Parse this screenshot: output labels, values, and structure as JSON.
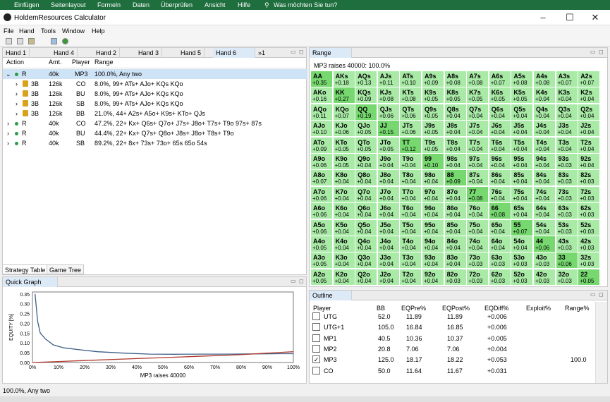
{
  "ribbon": [
    "Einfügen",
    "Seitenlayout",
    "Formeln",
    "Daten",
    "Überprüfen",
    "Ansicht",
    "Hilfe",
    "Was möchten Sie tun?"
  ],
  "window": {
    "title": "HoldemResources Calculator"
  },
  "menu": [
    "File",
    "Hand",
    "Tools",
    "Window",
    "Help"
  ],
  "hand_tabs": [
    "Hand 1",
    "Hand 4",
    "Hand 2",
    "Hand 3",
    "Hand 5",
    "Hand 6",
    "»1"
  ],
  "tree": {
    "headers": [
      "Action",
      "Amt.",
      "Player",
      "Range"
    ],
    "rows": [
      {
        "action": "R",
        "amt": "40k",
        "player": "MP3",
        "range": "100.0%, Any two"
      },
      {
        "action": "3B",
        "amt": "126k",
        "player": "CO",
        "range": "8.0%, 99+ ATs+ AJo+ KQs KQo"
      },
      {
        "action": "3B",
        "amt": "126k",
        "player": "BU",
        "range": "8.0%, 99+ ATs+ AJo+ KQs KQo"
      },
      {
        "action": "3B",
        "amt": "126k",
        "player": "SB",
        "range": "8.0%, 99+ ATs+ AJo+ KQs KQo"
      },
      {
        "action": "3B",
        "amt": "126k",
        "player": "BB",
        "range": "21.0%, 44+ A2s+ A5o+ K9s+ KTo+ QJs"
      },
      {
        "action": "R",
        "amt": "40k",
        "player": "CO",
        "range": "47.2%, 22+ Kx+ Q6s+ Q7o+ J7s+ J8o+ T7s+ T9o 97s+ 87s"
      },
      {
        "action": "R",
        "amt": "40k",
        "player": "BU",
        "range": "44.4%, 22+ Kx+ Q7s+ Q8o+ J8s+ J8o+ T8s+ T9o"
      },
      {
        "action": "R",
        "amt": "40k",
        "player": "SB",
        "range": "89.2%, 22+ 8x+ 73s+ 73o+ 65s 65o 54s"
      }
    ],
    "bottom_tabs": [
      "Strategy Table",
      "Game Tree"
    ]
  },
  "range_panel": {
    "tab": "Range",
    "subtitle": "MP3 raises 40000: 100.0%",
    "hands": [
      [
        "AA",
        "AKs",
        "AQs",
        "AJs",
        "ATs",
        "A9s",
        "A8s",
        "A7s",
        "A6s",
        "A5s",
        "A4s",
        "A3s",
        "A2s"
      ],
      [
        "AKo",
        "KK",
        "KQs",
        "KJs",
        "KTs",
        "K9s",
        "K8s",
        "K7s",
        "K6s",
        "K5s",
        "K4s",
        "K3s",
        "K2s"
      ],
      [
        "AQo",
        "KQo",
        "QQ",
        "QJs",
        "QTs",
        "Q9s",
        "Q8s",
        "Q7s",
        "Q6s",
        "Q5s",
        "Q4s",
        "Q3s",
        "Q2s"
      ],
      [
        "AJo",
        "KJo",
        "QJo",
        "JJ",
        "JTs",
        "J9s",
        "J8s",
        "J7s",
        "J6s",
        "J5s",
        "J4s",
        "J3s",
        "J2s"
      ],
      [
        "ATo",
        "KTo",
        "QTo",
        "JTo",
        "TT",
        "T9s",
        "T8s",
        "T7s",
        "T6s",
        "T5s",
        "T4s",
        "T3s",
        "T2s"
      ],
      [
        "A9o",
        "K9o",
        "Q9o",
        "J9o",
        "T9o",
        "99",
        "98s",
        "97s",
        "96s",
        "95s",
        "94s",
        "93s",
        "92s"
      ],
      [
        "A8o",
        "K8o",
        "Q8o",
        "J8o",
        "T8o",
        "98o",
        "88",
        "87s",
        "86s",
        "85s",
        "84s",
        "83s",
        "82s"
      ],
      [
        "A7o",
        "K7o",
        "Q7o",
        "J7o",
        "T7o",
        "97o",
        "87o",
        "77",
        "76s",
        "75s",
        "74s",
        "73s",
        "72s"
      ],
      [
        "A6o",
        "K6o",
        "Q6o",
        "J6o",
        "T6o",
        "96o",
        "86o",
        "76o",
        "66",
        "65s",
        "64s",
        "63s",
        "62s"
      ],
      [
        "A5o",
        "K5o",
        "Q5o",
        "J5o",
        "T5o",
        "95o",
        "85o",
        "75o",
        "65o",
        "55",
        "54s",
        "53s",
        "52s"
      ],
      [
        "A4o",
        "K4o",
        "Q4o",
        "J4o",
        "T4o",
        "94o",
        "84o",
        "74o",
        "64o",
        "54o",
        "44",
        "43s",
        "42s"
      ],
      [
        "A3o",
        "K3o",
        "Q3o",
        "J3o",
        "T3o",
        "93o",
        "83o",
        "73o",
        "63o",
        "53o",
        "43o",
        "33",
        "32s"
      ],
      [
        "A2o",
        "K2o",
        "Q2o",
        "J2o",
        "T2o",
        "92o",
        "82o",
        "72o",
        "62o",
        "52o",
        "42o",
        "32o",
        "22"
      ]
    ],
    "values": [
      [
        "+0.35",
        "+0.18",
        "+0.13",
        "+0.11",
        "+0.10",
        "+0.09",
        "+0.08",
        "+0.08",
        "+0.07",
        "+0.08",
        "+0.08",
        "+0.07",
        "+0.07"
      ],
      [
        "+0.16",
        "+0.27",
        "+0.09",
        "+0.08",
        "+0.08",
        "+0.05",
        "+0.05",
        "+0.05",
        "+0.05",
        "+0.05",
        "+0.04",
        "+0.04",
        "+0.04"
      ],
      [
        "+0.11",
        "+0.07",
        "+0.19",
        "+0.06",
        "+0.06",
        "+0.05",
        "+0.04",
        "+0.04",
        "+0.04",
        "+0.04",
        "+0.04",
        "+0.04",
        "+0.04"
      ],
      [
        "+0.10",
        "+0.06",
        "+0.05",
        "+0.15",
        "+0.06",
        "+0.05",
        "+0.04",
        "+0.04",
        "+0.04",
        "+0.04",
        "+0.04",
        "+0.04",
        "+0.04"
      ],
      [
        "+0.09",
        "+0.05",
        "+0.05",
        "+0.05",
        "+0.12",
        "+0.05",
        "+0.04",
        "+0.04",
        "+0.04",
        "+0.04",
        "+0.04",
        "+0.04",
        "+0.04"
      ],
      [
        "+0.06",
        "+0.05",
        "+0.04",
        "+0.04",
        "+0.04",
        "+0.10",
        "+0.04",
        "+0.04",
        "+0.04",
        "+0.04",
        "+0.04",
        "+0.03",
        "+0.04"
      ],
      [
        "+0.07",
        "+0.04",
        "+0.04",
        "+0.04",
        "+0.04",
        "+0.04",
        "+0.09",
        "+0.04",
        "+0.04",
        "+0.04",
        "+0.04",
        "+0.03",
        "+0.03"
      ],
      [
        "+0.06",
        "+0.04",
        "+0.04",
        "+0.04",
        "+0.04",
        "+0.04",
        "+0.04",
        "+0.08",
        "+0.04",
        "+0.04",
        "+0.04",
        "+0.03",
        "+0.03"
      ],
      [
        "+0.06",
        "+0.04",
        "+0.04",
        "+0.04",
        "+0.04",
        "+0.04",
        "+0.04",
        "+0.04",
        "+0.08",
        "+0.04",
        "+0.04",
        "+0.03",
        "+0.03"
      ],
      [
        "+0.06",
        "+0.04",
        "+0.04",
        "+0.04",
        "+0.04",
        "+0.04",
        "+0.04",
        "+0.04",
        "+0.04",
        "+0.07",
        "+0.04",
        "+0.03",
        "+0.03"
      ],
      [
        "+0.05",
        "+0.04",
        "+0.04",
        "+0.04",
        "+0.04",
        "+0.04",
        "+0.04",
        "+0.04",
        "+0.04",
        "+0.04",
        "+0.06",
        "+0.03",
        "+0.03"
      ],
      [
        "+0.05",
        "+0.04",
        "+0.04",
        "+0.04",
        "+0.04",
        "+0.04",
        "+0.04",
        "+0.03",
        "+0.03",
        "+0.03",
        "+0.03",
        "+0.06",
        "+0.03"
      ],
      [
        "+0.05",
        "+0.04",
        "+0.04",
        "+0.04",
        "+0.04",
        "+0.04",
        "+0.03",
        "+0.03",
        "+0.03",
        "+0.03",
        "+0.03",
        "+0.03",
        "+0.05"
      ]
    ],
    "colors": {
      "base": "#a9eaa7",
      "diagonal": "#76d86f",
      "divider": "#ffffff"
    }
  },
  "quick_graph": {
    "tab": "Quick Graph",
    "chart_data": {
      "type": "line",
      "xlabel": "MP3 raises 40000",
      "ylabel": "EQUITY [%]",
      "x_ticks": [
        "0%",
        "10%",
        "20%",
        "30%",
        "40%",
        "50%",
        "60%",
        "70%",
        "80%",
        "90%",
        "100%"
      ],
      "y_ticks": [
        "0.00",
        "0.05",
        "0.10",
        "0.15",
        "0.20",
        "0.25",
        "0.30",
        "0.35"
      ],
      "ylim": [
        0,
        0.36
      ],
      "xlim": [
        0,
        100
      ],
      "series": [
        {
          "color": "#3b5f86",
          "points": [
            [
              1,
              0.35
            ],
            [
              2,
              0.21
            ],
            [
              3,
              0.15
            ],
            [
              5,
              0.12
            ],
            [
              8,
              0.09
            ],
            [
              12,
              0.075
            ],
            [
              18,
              0.065
            ],
            [
              25,
              0.055
            ],
            [
              35,
              0.048
            ],
            [
              45,
              0.043
            ],
            [
              55,
              0.042
            ],
            [
              65,
              0.043
            ],
            [
              75,
              0.043
            ],
            [
              85,
              0.044
            ],
            [
              95,
              0.045
            ],
            [
              100,
              0.045
            ]
          ]
        },
        {
          "color": "#b03a2e",
          "points": [
            [
              0,
              0.0
            ],
            [
              10,
              0.005
            ],
            [
              20,
              0.01
            ],
            [
              30,
              0.015
            ],
            [
              40,
              0.02
            ],
            [
              50,
              0.025
            ],
            [
              60,
              0.03
            ],
            [
              70,
              0.035
            ],
            [
              80,
              0.04
            ],
            [
              90,
              0.048
            ],
            [
              100,
              0.055
            ]
          ]
        }
      ]
    }
  },
  "outline": {
    "tab": "Outline",
    "headers": [
      "Player",
      "BB",
      "EQPre%",
      "EQPost%",
      "EQDiff%",
      "Exploit%",
      "Range%"
    ],
    "rows": [
      {
        "player": "UTG",
        "bb": "52.0",
        "pre": "11.89",
        "post": "11.89",
        "diff": "+0.006",
        "exploit": "",
        "range": "",
        "checked": false
      },
      {
        "player": "UTG+1",
        "bb": "105.0",
        "pre": "16.84",
        "post": "16.85",
        "diff": "+0.006",
        "exploit": "",
        "range": "",
        "checked": false
      },
      {
        "player": "MP1",
        "bb": "40.5",
        "pre": "10.36",
        "post": "10.37",
        "diff": "+0.005",
        "exploit": "",
        "range": "",
        "checked": false
      },
      {
        "player": "MP2",
        "bb": "20.8",
        "pre": "7.06",
        "post": "7.06",
        "diff": "+0.004",
        "exploit": "",
        "range": "",
        "checked": false
      },
      {
        "player": "MP3",
        "bb": "125.0",
        "pre": "18.17",
        "post": "18.22",
        "diff": "+0.053",
        "exploit": "",
        "range": "100.0",
        "checked": true
      },
      {
        "player": "CO",
        "bb": "50.0",
        "pre": "11.64",
        "post": "11.67",
        "diff": "+0.031",
        "exploit": "",
        "range": "",
        "checked": false
      }
    ]
  },
  "status": {
    "text": "100.0%, Any two"
  }
}
